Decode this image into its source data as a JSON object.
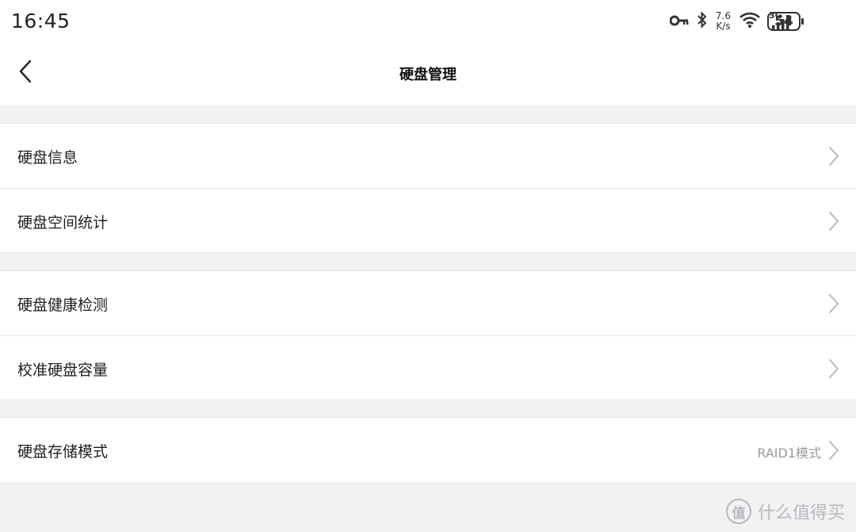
{
  "status_bar": {
    "time": "16:45",
    "net_speed_value": "7.6",
    "net_speed_unit": "K/s",
    "network_type": "3G",
    "battery": "54",
    "icons": [
      "key-icon",
      "bluetooth-icon",
      "wifi-icon",
      "cellular-signal-icon"
    ]
  },
  "header": {
    "title": "硬盘管理",
    "back_icon": "chevron-left-icon"
  },
  "groups": [
    {
      "items": [
        {
          "label": "硬盘信息",
          "value": ""
        },
        {
          "label": "硬盘空间统计",
          "value": ""
        }
      ]
    },
    {
      "items": [
        {
          "label": "硬盘健康检测",
          "value": ""
        },
        {
          "label": "校准硬盘容量",
          "value": ""
        }
      ]
    },
    {
      "items": [
        {
          "label": "硬盘存储模式",
          "value": "RAID1模式"
        }
      ]
    }
  ],
  "watermark": {
    "badge": "值",
    "text": "什么值得买"
  },
  "colors": {
    "background": "#f2f2f4",
    "card": "#ffffff",
    "divider": "#e6e6e8",
    "secondary_text": "#9a9a9a"
  }
}
